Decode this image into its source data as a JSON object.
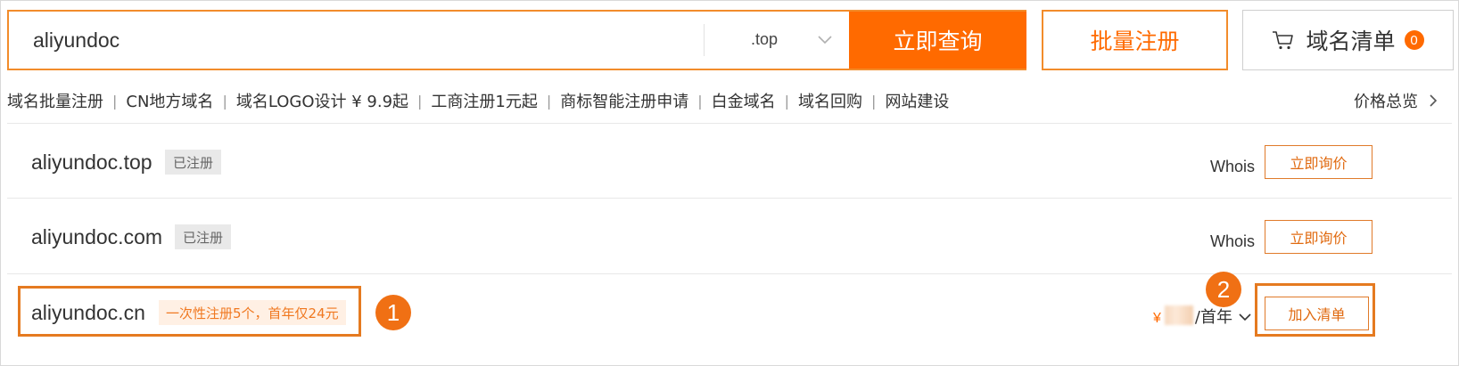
{
  "search": {
    "query": "aliyundoc",
    "suffix": ".top",
    "search_button": "立即查询"
  },
  "actions": {
    "bulk_register": "批量注册",
    "cart_label": "域名清单",
    "cart_count": "0"
  },
  "quick_links": [
    "域名批量注册",
    "CN地方域名",
    "域名LOGO设计 ¥ 9.9起",
    "工商注册1元起",
    "商标智能注册申请",
    "白金域名",
    "域名回购",
    "网站建设"
  ],
  "price_overview": "价格总览",
  "results": [
    {
      "domain": "aliyundoc.top",
      "status": "已注册",
      "whois": "Whois",
      "action": "立即询价"
    },
    {
      "domain": "aliyundoc.com",
      "status": "已注册",
      "whois": "Whois",
      "action": "立即询价"
    },
    {
      "domain": "aliyundoc.cn",
      "promo": "一次性注册5个，首年仅24元",
      "price_currency": "¥",
      "price_unit": "/首年",
      "action": "加入清单"
    }
  ],
  "callouts": {
    "step1": "1",
    "step2": "2"
  },
  "colors": {
    "accent": "#ff6a00",
    "highlight": "#e57a20"
  }
}
